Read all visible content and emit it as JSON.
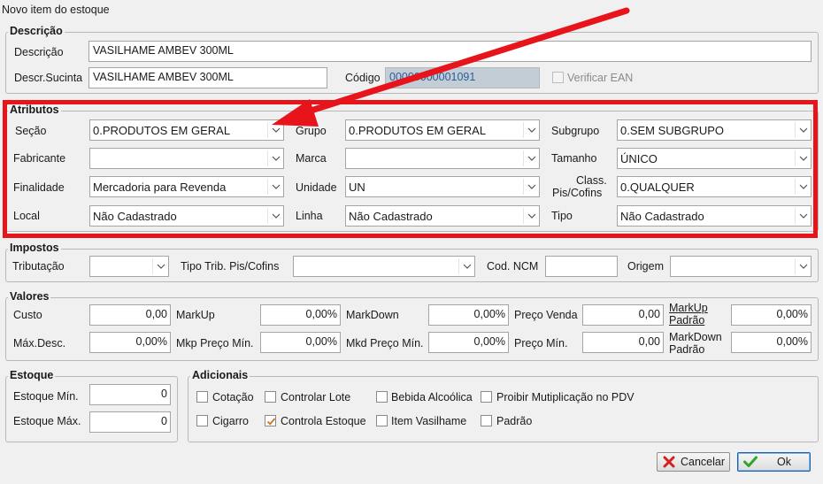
{
  "window": {
    "title": "Novo item do estoque"
  },
  "descricao": {
    "legend": "Descrição",
    "descricao_label": "Descrição",
    "descricao_value": "VASILHAME AMBEV 300ML",
    "sucinta_label": "Descr.Sucinta",
    "sucinta_value": "VASILHAME AMBEV 300ML",
    "codigo_label": "Código",
    "codigo_value": "00000000001091",
    "ean_label": "Verificar EAN"
  },
  "atributos": {
    "legend": "Atributos",
    "secao_label": "Seção",
    "secao_value": "0.PRODUTOS EM GERAL",
    "grupo_label": "Grupo",
    "grupo_value": "0.PRODUTOS EM GERAL",
    "subgrupo_label": "Subgrupo",
    "subgrupo_value": "0.SEM SUBGRUPO",
    "fabricante_label": "Fabricante",
    "fabricante_value": "",
    "marca_label": "Marca",
    "marca_value": "",
    "tamanho_label": "Tamanho",
    "tamanho_value": "ÚNICO",
    "finalidade_label": "Finalidade",
    "finalidade_value": "Mercadoria para Revenda",
    "unidade_label": "Unidade",
    "unidade_value": "UN",
    "class_label_1": "Class.",
    "class_label_2": "Pis/Cofins",
    "class_value": "0.QUALQUER",
    "local_label": "Local",
    "local_value": "Não Cadastrado",
    "linha_label": "Linha",
    "linha_value": "Não Cadastrado",
    "tipo_label": "Tipo",
    "tipo_value": "Não Cadastrado"
  },
  "impostos": {
    "legend": "Impostos",
    "tributacao_label": "Tributação",
    "tipo_trib_label": "Tipo Trib. Pis/Cofins",
    "ncm_label": "Cod. NCM",
    "origem_label": "Origem"
  },
  "valores": {
    "legend": "Valores",
    "custo_label": "Custo",
    "custo_value": "0,00",
    "markup_label": "MarkUp",
    "markup_value": "0,00%",
    "markdown_label": "MarkDown",
    "markdown_value": "0,00%",
    "preco_venda_label": "Preço Venda",
    "preco_venda_value": "0,00",
    "markup_padrao_label_1": "MarkUp",
    "markup_padrao_label_2": "Padrão",
    "markup_padrao_value": "0,00%",
    "maxdesc_label": "Máx.Desc.",
    "maxdesc_value": "0,00%",
    "mkp_preco_min_label": "Mkp Preço Mín.",
    "mkp_preco_min_value": "0,00%",
    "mkd_preco_min_label": "Mkd Preço Mín.",
    "mkd_preco_min_value": "0,00%",
    "preco_min_label": "Preço Mín.",
    "preco_min_value": "0,00",
    "markdown_padrao_label_1": "MarkDown",
    "markdown_padrao_label_2": "Padrão",
    "markdown_padrao_value": "0,00%"
  },
  "estoque": {
    "legend": "Estoque",
    "min_label": "Estoque Mín.",
    "min_value": "0",
    "max_label": "Estoque Máx.",
    "max_value": "0"
  },
  "adicionais": {
    "legend": "Adicionais",
    "cotacao": "Cotação",
    "controlar_lote": "Controlar Lote",
    "bebida_alcoolica": "Bebida Alcoólica",
    "proibir_multiplicacao": "Proibir Mutiplicação no PDV",
    "cigarro": "Cigarro",
    "controla_estoque": "Controla Estoque",
    "item_vasilhame": "Item Vasilhame",
    "padrao": "Padrão",
    "controla_estoque_checked": true
  },
  "buttons": {
    "cancel": "Cancelar",
    "ok": "Ok"
  },
  "colors": {
    "highlight": "#e8141c",
    "codigo_bg": "#c3cdd6",
    "codigo_text": "#2a5d9a",
    "ok_check": "#2ea52e",
    "cancel_x": "#d42020"
  }
}
